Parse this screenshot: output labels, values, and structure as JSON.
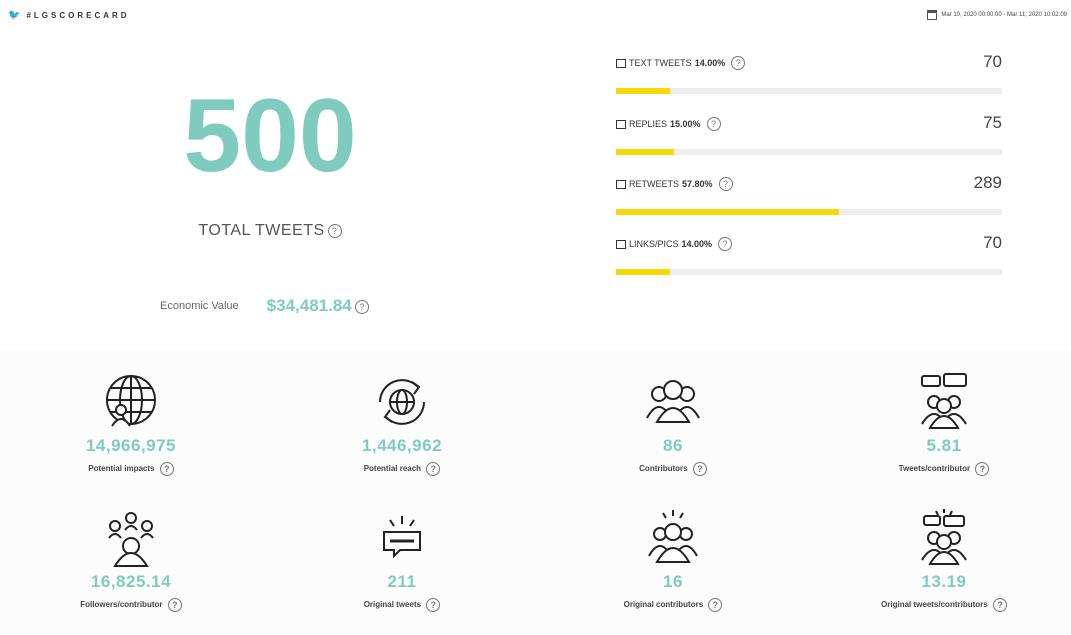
{
  "header": {
    "hashtag": "#LGSCORECARD",
    "date_range": "Mar 10, 2020 00:00:00 - Mar 11, 2020 10:02:09"
  },
  "hero": {
    "total": "500",
    "total_label": "TOTAL TWEETS",
    "economic_label": "Economic Value",
    "economic_value": "$34,481.84"
  },
  "metrics": [
    {
      "label": "TEXT TWEETS",
      "pct": "14.00%",
      "value": "70",
      "fraction": 0.14,
      "icon": "document-icon"
    },
    {
      "label": "REPLIES",
      "pct": "15.00%",
      "value": "75",
      "fraction": 0.15,
      "icon": "replies-icon"
    },
    {
      "label": "RETWEETS",
      "pct": "57.80%",
      "value": "289",
      "fraction": 0.578,
      "icon": "retweet-icon"
    },
    {
      "label": "LINKS/PICS",
      "pct": "14.00%",
      "value": "70",
      "fraction": 0.14,
      "icon": "image-icon"
    }
  ],
  "stats": [
    {
      "value": "14,966,975",
      "caption": "Potential impacts",
      "icon": "globe-people-icon"
    },
    {
      "value": "1,446,962",
      "caption": "Potential reach",
      "icon": "globe-cycle-icon"
    },
    {
      "value": "86",
      "caption": "Contributors",
      "icon": "people-group-icon"
    },
    {
      "value": "5.81",
      "caption": "Tweets/contributor",
      "icon": "people-chat-icon"
    },
    {
      "value": "16,825.14",
      "caption": "Followers/contributor",
      "icon": "follower-network-icon"
    },
    {
      "value": "211",
      "caption": "Original tweets",
      "icon": "message-burst-icon"
    },
    {
      "value": "16",
      "caption": "Original contributors",
      "icon": "people-burst-icon"
    },
    {
      "value": "13.19",
      "caption": "Original tweets/contributors",
      "icon": "people-chat-burst-icon"
    }
  ],
  "colors": {
    "accent": "#7fccbf",
    "bar": "#f5d90a",
    "track": "#eeeeee"
  }
}
